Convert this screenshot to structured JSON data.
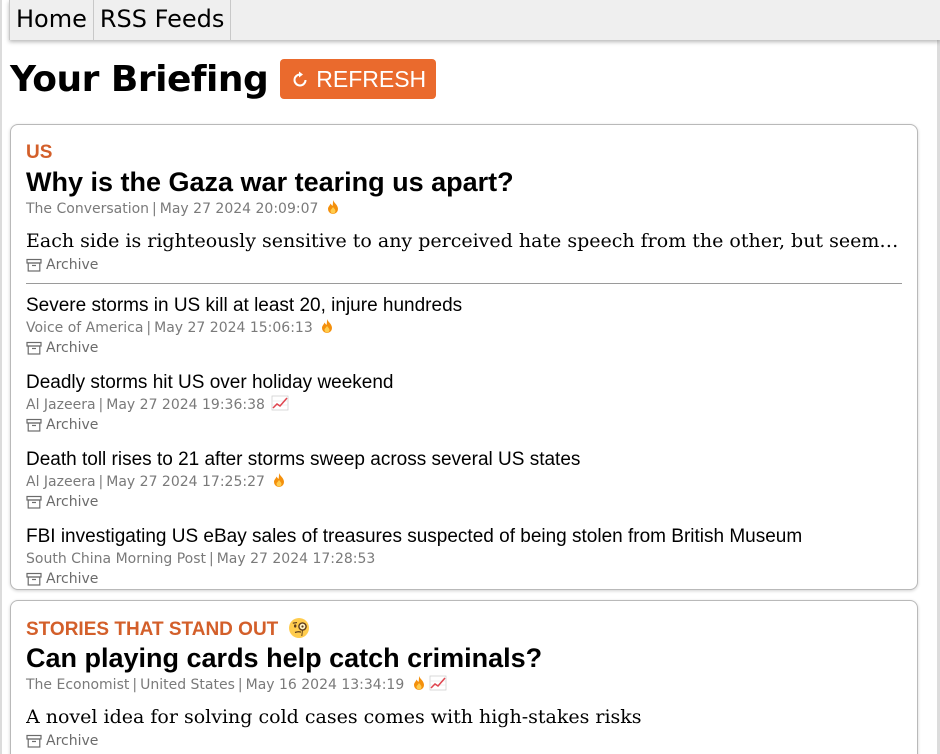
{
  "nav": {
    "items": [
      {
        "label": "Home"
      },
      {
        "label": "RSS Feeds"
      }
    ]
  },
  "header": {
    "title": "Your Briefing",
    "refresh_label": "REFRESH"
  },
  "colors": {
    "accent": "#ea6a2d",
    "section_label": "#d35f2a"
  },
  "cards": [
    {
      "section": "US",
      "lead": {
        "title": "Why is the Gaza war tearing us apart?",
        "source": "The Conversation",
        "date": "May 27 2024 20:09:07",
        "indicator": "fire-icon",
        "summary": "Each side is righteously sensitive to any perceived hate speech from the other, but seems un...",
        "archive_label": "Archive"
      },
      "stories": [
        {
          "title": "Severe storms in US kill at least 20, injure hundreds",
          "source": "Voice of America",
          "date": "May 27 2024 15:06:13",
          "indicator": "fire-icon",
          "archive_label": "Archive"
        },
        {
          "title": "Deadly storms hit US over holiday weekend",
          "source": "Al Jazeera",
          "date": "May 27 2024 19:36:38",
          "indicator": "trending-icon",
          "archive_label": "Archive"
        },
        {
          "title": "Death toll rises to 21 after storms sweep across several US states",
          "source": "Al Jazeera",
          "date": "May 27 2024 17:25:27",
          "indicator": "fire-icon",
          "archive_label": "Archive"
        },
        {
          "title": "FBI investigating US eBay sales of treasures suspected of being stolen from British Museum",
          "source": "South China Morning Post",
          "date": "May 27 2024 17:28:53",
          "indicator": "",
          "archive_label": "Archive"
        }
      ]
    },
    {
      "section": "STORIES THAT STAND OUT",
      "section_icon": "monocle-face-icon",
      "lead": {
        "title": "Can playing cards help catch criminals?",
        "source": "The Economist",
        "region": "United States",
        "date": "May 16 2024 13:34:19",
        "indicators": [
          "fire-icon",
          "trending-icon"
        ],
        "summary": "A novel idea for solving cold cases comes with high-stakes risks",
        "archive_label": "Archive"
      }
    }
  ]
}
